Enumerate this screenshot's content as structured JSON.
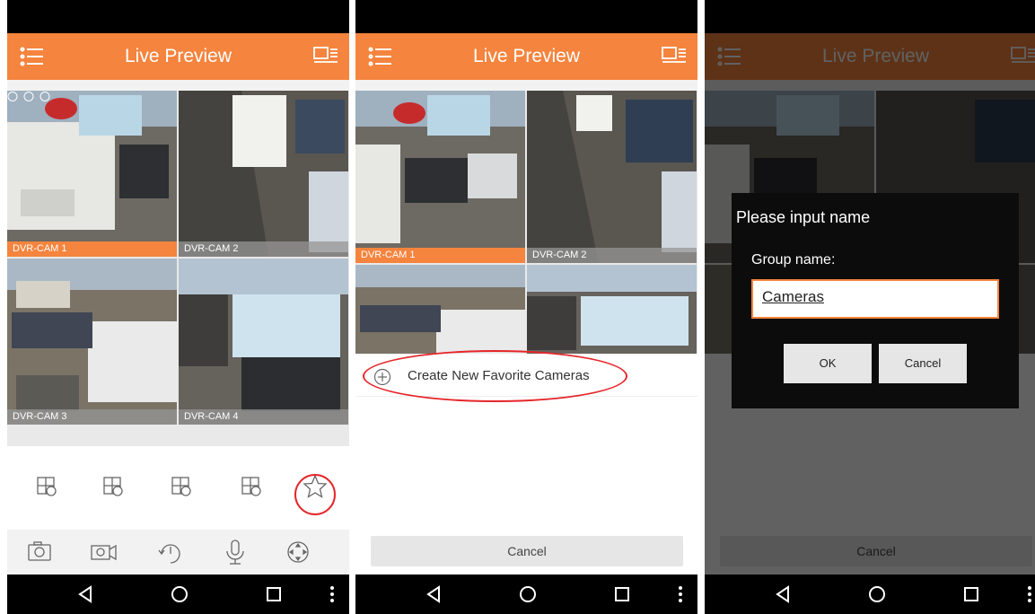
{
  "app": {
    "title": "Live Preview"
  },
  "cameras": [
    "DVR-CAM 1",
    "DVR-CAM 2",
    "DVR-CAM 3",
    "DVR-CAM 4"
  ],
  "split_options": [
    "4-split",
    "9-split",
    "16-split",
    "clear-split"
  ],
  "favorites": {
    "create_label": "Create New Favorite Cameras",
    "cancel_label": "Cancel"
  },
  "dialog": {
    "title": "Please input name",
    "field_label": "Group name:",
    "field_value": "Cameras",
    "ok_label": "OK",
    "cancel_label": "Cancel"
  },
  "colors": {
    "accent": "#f5843e",
    "highlight": "#e5262a",
    "statusbar": "#000000"
  }
}
